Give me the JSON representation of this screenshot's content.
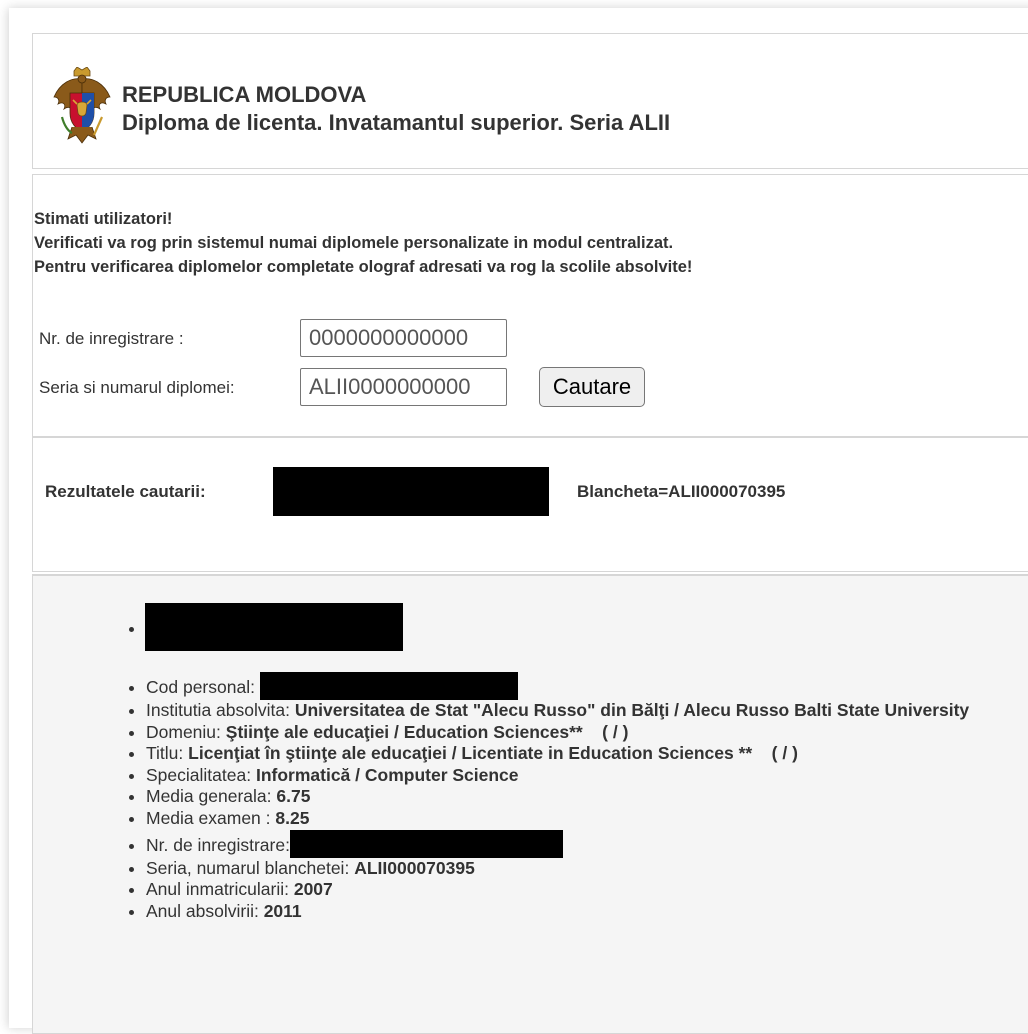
{
  "header": {
    "country": "REPUBLICA MOLDOVA",
    "subtitle": "Diploma de licenta. Invatamantul superior. Seria ALII"
  },
  "notice": {
    "line1": "Stimati utilizatori!",
    "line2": "Verificati va rog prin sistemul numai diplomele personalizate in modul centralizat.",
    "line3": "Pentru verificarea diplomelor completate olograf adresati va rog la scolile absolvite!"
  },
  "form": {
    "reg_label": "Nr. de inregistrare :",
    "reg_value": "0000000000000",
    "serie_label": "Seria si numarul diplomei:",
    "serie_value": "ALII0000000000",
    "search_button": "Cautare"
  },
  "results": {
    "label": "Rezultatele cautarii:",
    "blancheta": "Blancheta=ALII000070395"
  },
  "details": {
    "cod_label": "Cod personal:",
    "inst_label": "Institutia absolvita:",
    "inst_value": "Universitatea de Stat \"Alecu Russo\" din Bălţi / Alecu Russo Balti State University",
    "domeniu_label": "Domeniu:",
    "domeniu_value": "Ştiinţe ale educaţiei / Education Sciences**    ( / )",
    "titlu_label": "Titlu:",
    "titlu_value": "Licenţiat în ştiinţe ale educaţiei / Licentiate in Education Sciences **    ( / )",
    "spec_label": "Specialitatea:",
    "spec_value": "Informatică / Computer Science",
    "media_gen_label": "Media generala:",
    "media_gen_value": "6.75",
    "media_ex_label": "Media examen :",
    "media_ex_value": "8.25",
    "nr_reg_label": "Nr. de inregistrare:",
    "serie_bl_label": "Seria, numarul blanchetei:",
    "serie_bl_value": "ALII000070395",
    "an_inm_label": "Anul inmatricularii:",
    "an_inm_value": "2007",
    "an_abs_label": "Anul absolvirii:",
    "an_abs_value": "2011"
  },
  "icons": {
    "coat": "moldova-coat-of-arms-icon"
  },
  "colors": {
    "text": "#333333",
    "details_bg": "#f5f5f5",
    "border": "#d6d6d6",
    "redaction": "#000000"
  }
}
